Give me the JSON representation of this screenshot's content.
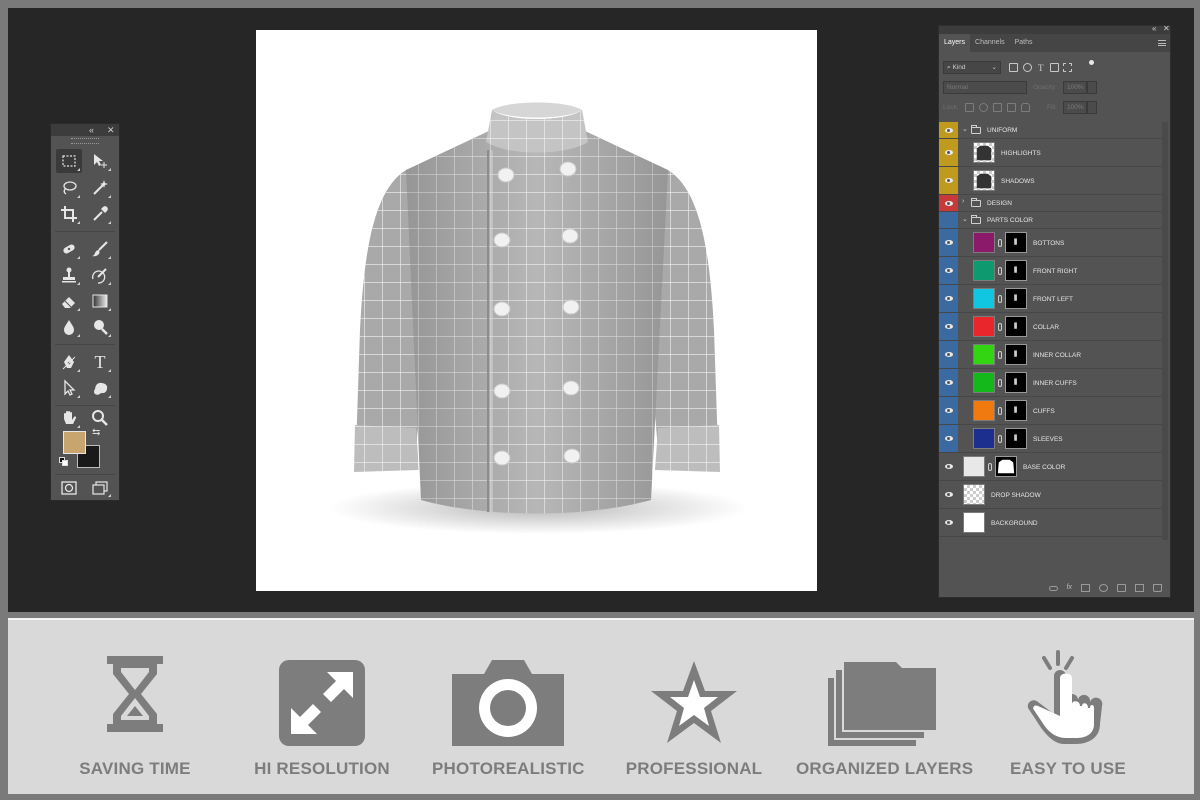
{
  "colors": {
    "frame": "#7a7a7a",
    "workspace": "#262626",
    "panel": "#535353",
    "eye_yellow": "#c09a1c",
    "eye_red": "#c83a3a",
    "eye_blue": "#3b6aa0",
    "feature_icon": "#7d7d7d",
    "foreground_swatch": "#c8a46e",
    "background_swatch": "#1a1a1a"
  },
  "tools": {
    "items": [
      "marquee-icon",
      "move-icon",
      "lasso-icon",
      "magic-wand-icon",
      "crop-icon",
      "eyedropper-icon",
      "healing-icon",
      "brush-icon",
      "stamp-icon",
      "history-brush-icon",
      "eraser-icon",
      "gradient-icon",
      "blur-icon",
      "dodge-icon",
      "pen-icon",
      "type-icon",
      "path-select-icon",
      "shape-icon",
      "hand-icon",
      "zoom-icon"
    ],
    "text_tool_glyph": "T"
  },
  "layers_panel": {
    "tabs": [
      "Layers",
      "Channels",
      "Paths"
    ],
    "filter_label": "Kind",
    "blend_mode": "Normal",
    "opacity_label": "Opacity:",
    "opacity_value": "100%",
    "lock_label": "Lock:",
    "fill_label": "Fill:",
    "fill_value": "100%",
    "footer_icons": [
      "link-icon",
      "fx-icon",
      "mask-icon",
      "adjustment-icon",
      "group-icon",
      "new-layer-icon",
      "trash-icon"
    ],
    "fx_glyph": "fx",
    "layers": [
      {
        "name": "UNIFORM",
        "kind": "group",
        "eye": "yellow",
        "expanded": true
      },
      {
        "name": "HIGHLIGHTS",
        "kind": "image",
        "eye": "yellow"
      },
      {
        "name": "SHADOWS",
        "kind": "image",
        "eye": "yellow"
      },
      {
        "name": "DESIGN",
        "kind": "group",
        "eye": "red",
        "expanded": false
      },
      {
        "name": "PARTS COLOR",
        "kind": "group",
        "eye": "blue",
        "expanded": true
      },
      {
        "name": "BOTTONS",
        "kind": "color",
        "eye": "blue",
        "swatch": "#8b1a6b"
      },
      {
        "name": "FRONT RIGHT",
        "kind": "color",
        "eye": "blue",
        "swatch": "#0e9a6e"
      },
      {
        "name": "FRONT LEFT",
        "kind": "color",
        "eye": "blue",
        "swatch": "#11c6e0"
      },
      {
        "name": "COLLAR",
        "kind": "color",
        "eye": "blue",
        "swatch": "#e8262c"
      },
      {
        "name": "INNER COLLAR",
        "kind": "color",
        "eye": "blue",
        "swatch": "#33d412"
      },
      {
        "name": "INNER CUFFS",
        "kind": "color",
        "eye": "blue",
        "swatch": "#15b81a"
      },
      {
        "name": "CUFFS",
        "kind": "color",
        "eye": "blue",
        "swatch": "#f07a10"
      },
      {
        "name": "SLEEVES",
        "kind": "color",
        "eye": "blue",
        "swatch": "#1d2f8e"
      },
      {
        "name": "BASE COLOR",
        "kind": "color",
        "eye": "gray",
        "swatch": "#e8e8e8"
      },
      {
        "name": "DROP SHADOW",
        "kind": "transparent",
        "eye": "gray"
      },
      {
        "name": "BACKGROUND",
        "kind": "white",
        "eye": "gray"
      }
    ]
  },
  "features": [
    {
      "label": "SAVING TIME",
      "icon": "hourglass-icon"
    },
    {
      "label": "HI RESOLUTION",
      "icon": "expand-icon"
    },
    {
      "label": "PHOTOREALISTIC",
      "icon": "camera-icon"
    },
    {
      "label": "PROFESSIONAL",
      "icon": "star-icon"
    },
    {
      "label": "ORGANIZED LAYERS",
      "icon": "folders-icon"
    },
    {
      "label": "EASY TO USE",
      "icon": "hand-pointer-icon"
    }
  ]
}
